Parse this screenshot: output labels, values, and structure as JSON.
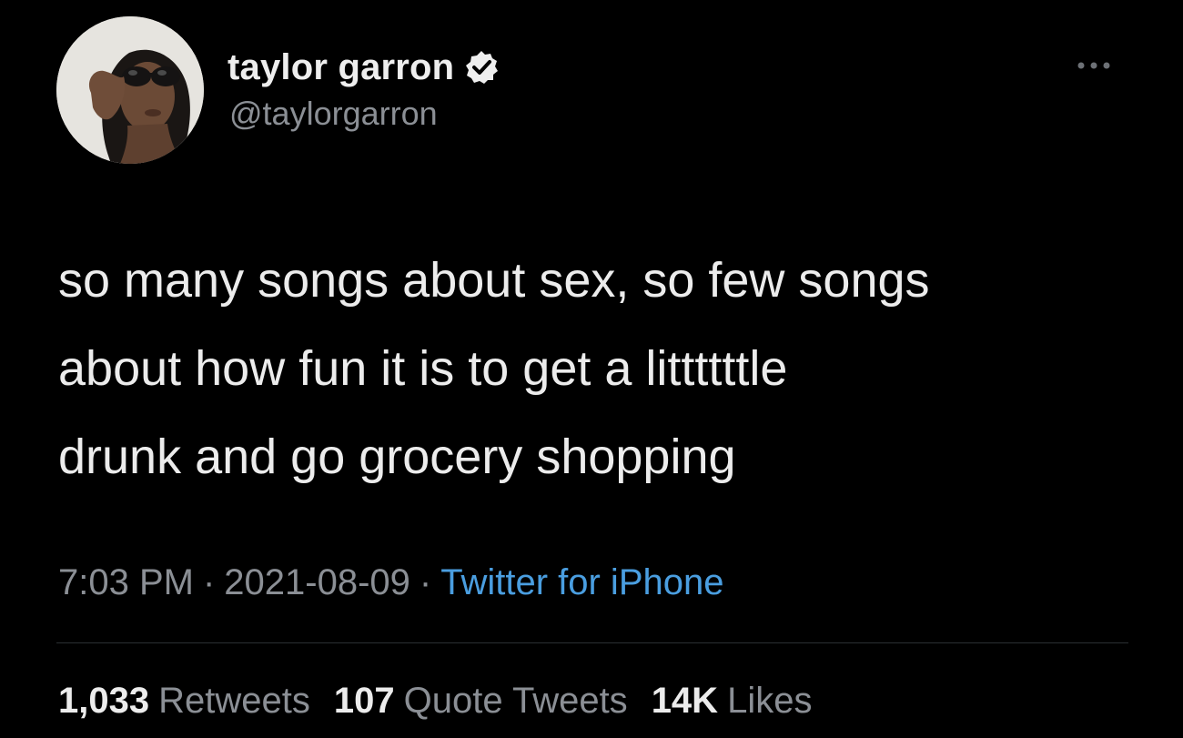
{
  "author": {
    "display_name": "taylor garron",
    "handle": "@taylorgarron",
    "verified": true,
    "avatar_icon": "profile-photo"
  },
  "tweet": {
    "text": "so many songs about sex, so few songs\nabout how fun it is to get a littttttle\ndrunk and go grocery shopping",
    "time": "7:03 PM",
    "date": "2021-08-09",
    "separator": "·",
    "source": "Twitter for iPhone"
  },
  "stats": {
    "retweets_count": "1,033",
    "retweets_label": "Retweets",
    "quotes_count": "107",
    "quotes_label": "Quote Tweets",
    "likes_count": "14K",
    "likes_label": "Likes"
  },
  "icons": {
    "more": "more-dots-icon",
    "verified": "verified-badge-icon"
  },
  "colors": {
    "background": "#000000",
    "text": "#e7e9ea",
    "secondary": "#8b8f95",
    "link": "#4a9ee0",
    "divider": "#2b2f33"
  }
}
